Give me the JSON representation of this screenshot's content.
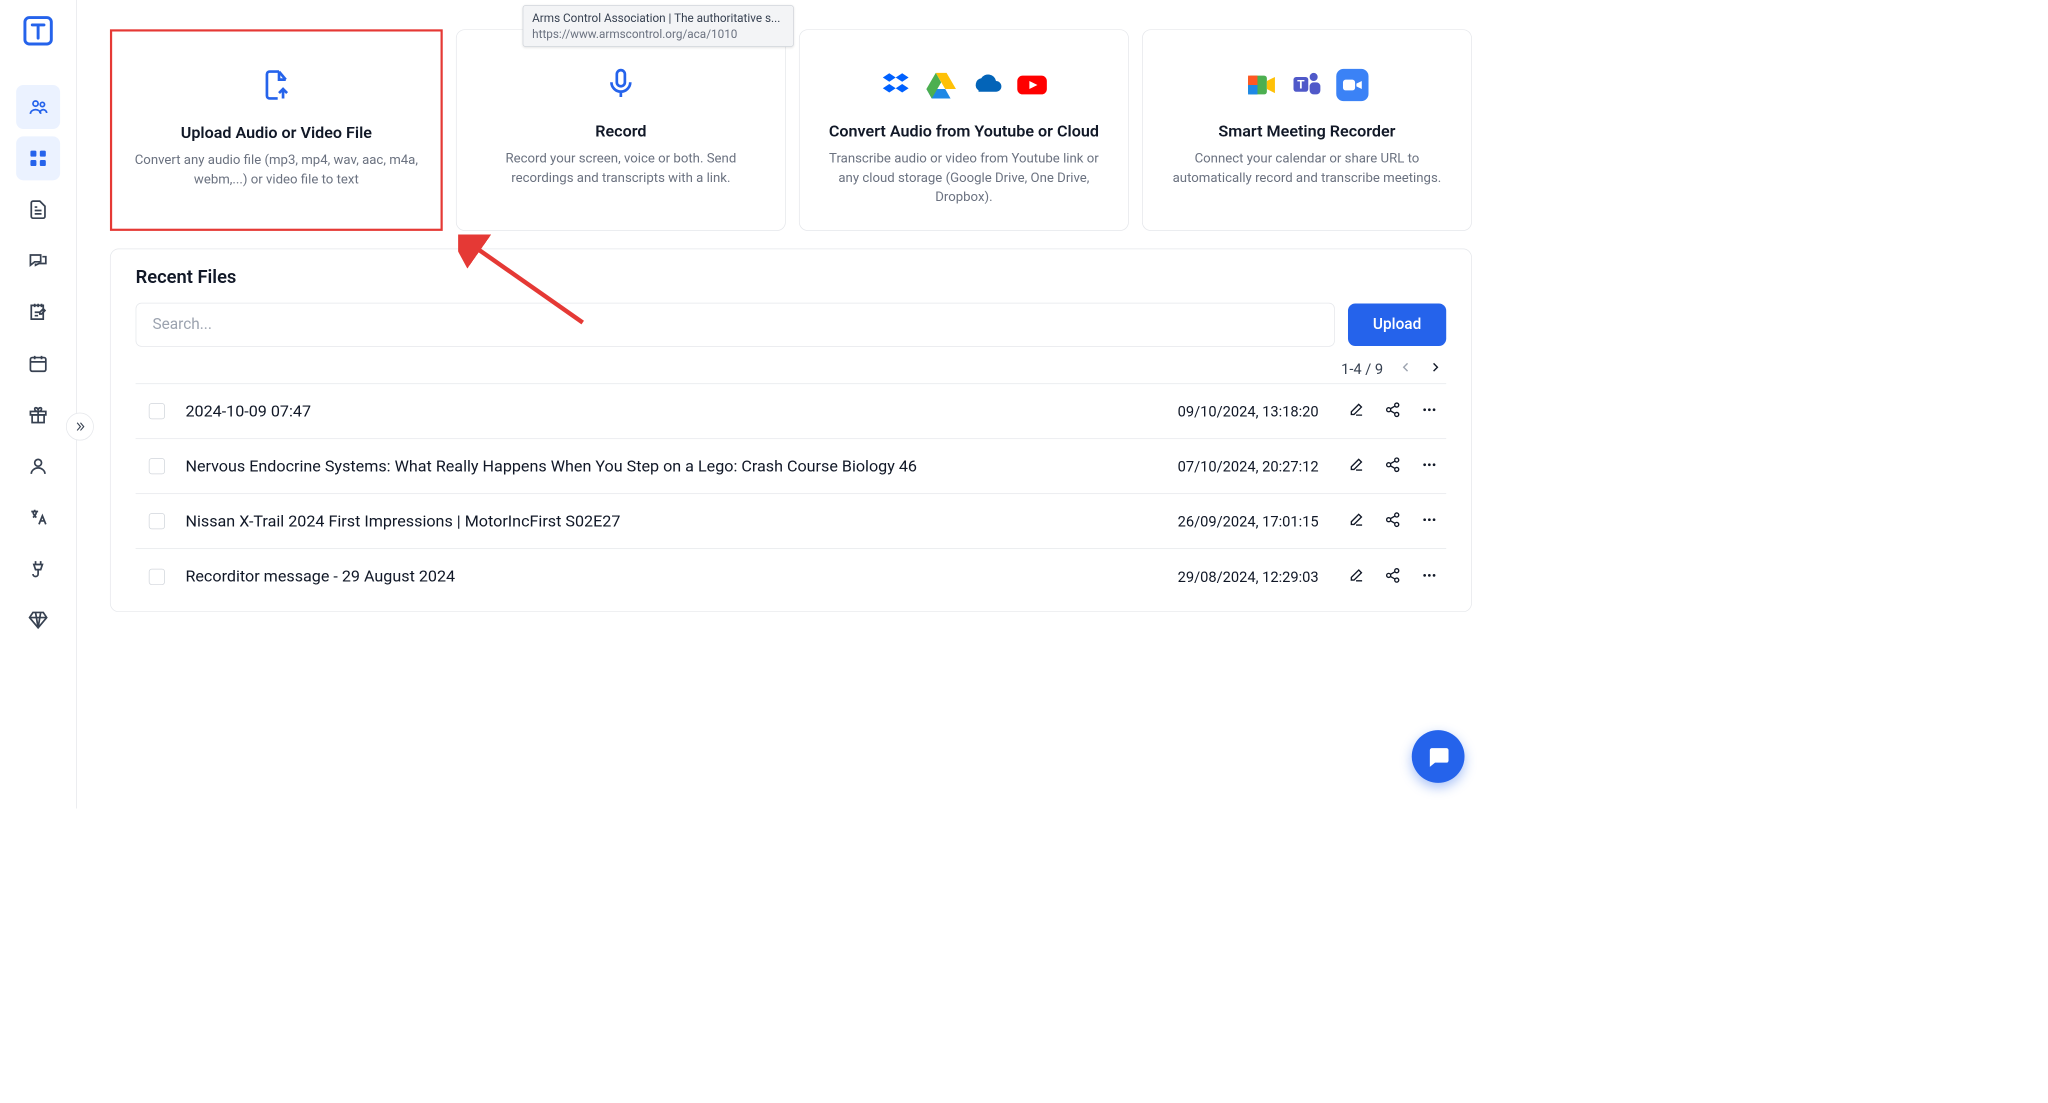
{
  "tooltip": {
    "title": "Arms Control Association | The authoritative s...",
    "url": "https://www.armscontrol.org/aca/1010"
  },
  "cards": {
    "upload": {
      "title": "Upload Audio or Video File",
      "desc": "Convert any audio file (mp3, mp4, wav, aac, m4a, webm,...) or video file to text"
    },
    "record": {
      "title": "Record",
      "desc": "Record your screen, voice or both. Send recordings and transcripts with a link."
    },
    "convert": {
      "title": "Convert Audio from Youtube or Cloud",
      "desc": "Transcribe audio or video from Youtube link or any cloud storage (Google Drive, One Drive, Dropbox)."
    },
    "meeting": {
      "title": "Smart Meeting Recorder",
      "desc": "Connect your calendar or share URL to automatically record and transcribe meetings."
    }
  },
  "recent": {
    "heading": "Recent Files",
    "search_placeholder": "Search...",
    "upload_label": "Upload",
    "pager": "1-4 / 9",
    "rows": [
      {
        "title": "2024-10-09 07:47",
        "date": "09/10/2024, 13:18:20"
      },
      {
        "title": "Nervous Endocrine Systems: What Really Happens When You Step on a Lego: Crash Course Biology 46",
        "date": "07/10/2024, 20:27:12"
      },
      {
        "title": "Nissan X-Trail 2024 First Impressions | MotorIncFirst S02E27",
        "date": "26/09/2024, 17:01:15"
      },
      {
        "title": "Recorditor message - 29 August 2024",
        "date": "29/08/2024, 12:29:03"
      }
    ]
  }
}
